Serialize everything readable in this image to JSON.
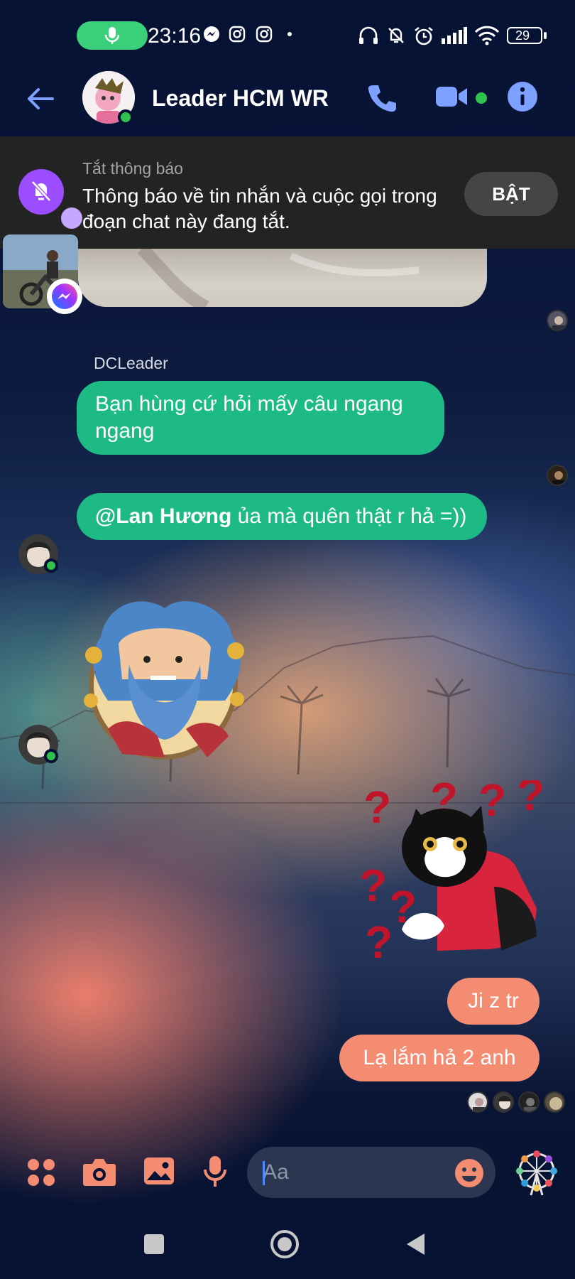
{
  "status_bar": {
    "time": "23:16",
    "battery": "29"
  },
  "header": {
    "title": "Leader HCM WR"
  },
  "mute_banner": {
    "title": "Tắt thông báo",
    "text": "Thông báo về tin nhắn và cuộc gọi trong đoạn chat này đang tắt.",
    "button_label": "BẬT"
  },
  "messages": {
    "sender_name": "DCLeader",
    "msg1": "Bạn hùng cứ hỏi mấy câu ngang ngang",
    "msg2_mention": "@Lan Hương",
    "msg2_text": " ủa mà quên thật r hả =))",
    "msg3": "Ji z tr",
    "msg4": "Lạ lắm hả 2 anh"
  },
  "composer": {
    "placeholder": "Aa"
  },
  "colors": {
    "incoming_bubble": "#1dba86",
    "outgoing_bubble": "#f48c72",
    "accent_icon": "#f48c72",
    "header_icon": "#7ea0ff",
    "background": "#061133"
  }
}
